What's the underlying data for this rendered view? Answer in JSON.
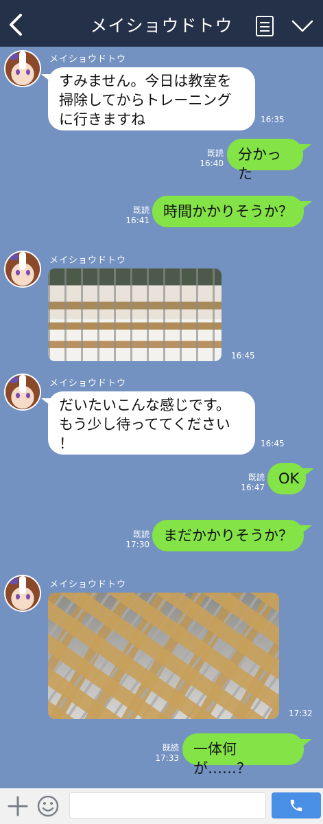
{
  "header": {
    "title": "メイショウドトウ"
  },
  "messages": [
    {
      "sender": "メイショウドトウ",
      "text": "すみません。今日は教室を\n掃除してからトレーニング\nに行きますね",
      "time": "16:35"
    },
    {
      "read": "既読",
      "text": "分かった",
      "time": "16:40"
    },
    {
      "read": "既読",
      "text": "時間かかりそうか？",
      "time": "16:41"
    },
    {
      "sender": "メイショウドトウ",
      "time": "16:45"
    },
    {
      "sender": "メイショウドトウ",
      "text": "だいたいこんな感じです。\nもう少し待っててください\n！",
      "time": "16:45"
    },
    {
      "read": "既読",
      "text": "OK",
      "time": "16:47"
    },
    {
      "read": "既読",
      "text": "まだかかりそうか？",
      "time": "17:30"
    },
    {
      "sender": "メイショウドトウ",
      "time": "17:32"
    },
    {
      "read": "既読",
      "text": "一体何が……？",
      "time": "17:33"
    }
  ],
  "footer": {
    "input_placeholder": ""
  },
  "colors": {
    "background": "#7391c1",
    "header": "#253148",
    "bubble_mine": "#84e346",
    "bubble_theirs": "#ffffff",
    "call_button": "#4a8fe6"
  }
}
